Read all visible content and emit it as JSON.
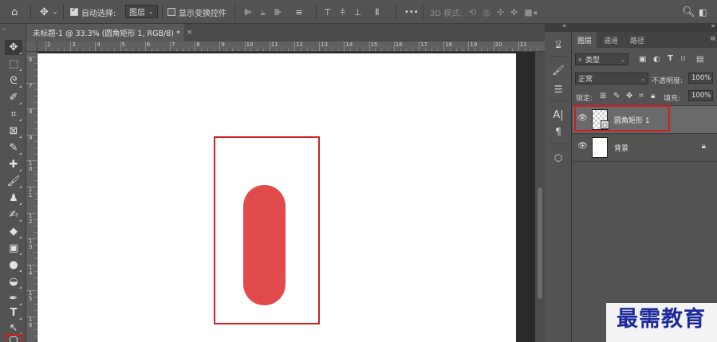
{
  "options_bar": {
    "home_icon": "home-icon",
    "move_icon": "move-tool-icon",
    "auto_select_label": "自动选择:",
    "auto_select_target": "图层",
    "show_transform_label": "显示变换控件",
    "three_d_mode_label": "3D 模式:",
    "more_label": "•••"
  },
  "document": {
    "tab_title": "未标题-1 @ 33.3% (圆角矩形 1, RGB/8) *",
    "close_glyph": "×"
  },
  "rulers": {
    "horizontal": [
      "2",
      "3",
      "4",
      "5",
      "6",
      "7",
      "8",
      "9",
      "10",
      "11",
      "12",
      "13",
      "14",
      "15",
      "16",
      "17",
      "18",
      "19",
      "20",
      "21"
    ],
    "vertical": [
      "6",
      "7",
      "8",
      "9",
      "10",
      "11",
      "12",
      "13",
      "14",
      "15",
      "16"
    ]
  },
  "tools": [
    "move-tool",
    "marquee-tool",
    "lasso-tool",
    "quick-select-tool",
    "crop-tool",
    "frame-tool",
    "eyedropper-tool",
    "healing-brush-tool",
    "brush-tool",
    "clone-stamp-tool",
    "history-brush-tool",
    "eraser-tool",
    "gradient-tool",
    "blur-tool",
    "dodge-tool",
    "pen-tool",
    "type-tool",
    "path-select-tool",
    "shape-tool"
  ],
  "canvas": {
    "shape_color": "#e24b4b",
    "highlight_color": "#cc2024"
  },
  "layers_panel": {
    "tabs": [
      "图层",
      "通道",
      "路径"
    ],
    "active_tab": "图层",
    "filter_kind": "类型",
    "blend_mode": "正常",
    "opacity_label": "不透明度:",
    "opacity_value": "100%",
    "lock_label": "锁定:",
    "fill_label": "填充:",
    "fill_value": "100%",
    "layers": [
      {
        "name": "圆角矩形 1",
        "selected": true,
        "locked": false
      },
      {
        "name": "背景",
        "selected": false,
        "locked": true
      }
    ]
  },
  "watermark": {
    "text": "最需教育"
  }
}
